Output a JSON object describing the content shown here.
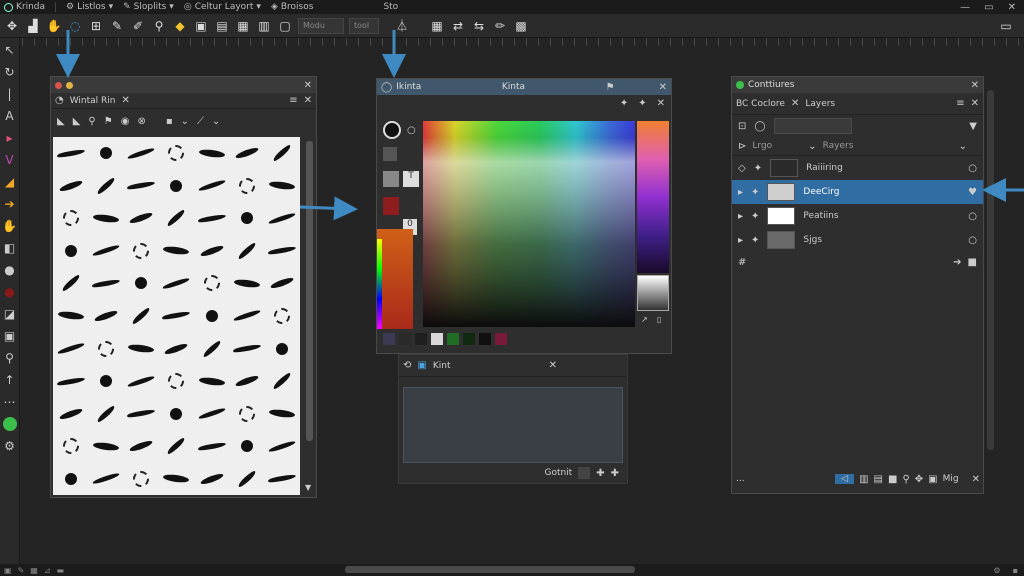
{
  "menubar": {
    "items": [
      {
        "label": "Krinda"
      },
      {
        "label": "Listlos"
      },
      {
        "label": "Sloplits"
      },
      {
        "label": "Celtur Layort"
      },
      {
        "label": "Broisos"
      },
      {
        "label": "Sto"
      }
    ]
  },
  "toolbar": {
    "field1": "Modu",
    "field2": "tool"
  },
  "brush_panel": {
    "tab_label": "Wintal Rin"
  },
  "color_panel": {
    "title_left": "Ikinta",
    "title_center": "Kinta",
    "swatch_label": "0",
    "colors": {
      "fg": "#111111",
      "red": "#8e1d1d",
      "orange": "#d06018"
    },
    "palette": [
      "#3a3a55",
      "#2a2a2a",
      "#1f1f1f",
      "#d8d8d8",
      "#1f6e23",
      "#0f2a10",
      "#101010",
      "#7a1a3a"
    ]
  },
  "sub_panel": {
    "tab_label": "Kint",
    "footer_label": "Gotnit"
  },
  "layers_panel": {
    "title": "Conttiures",
    "tabs": [
      "BC Coclore",
      "Layers"
    ],
    "header_left": "Lrgo",
    "header_right": "Rayers",
    "layers": [
      {
        "name": "Raiiiring",
        "selected": false,
        "thumb": "#2a2a2a"
      },
      {
        "name": "DeeCirg",
        "selected": true,
        "thumb": "#cfcfcf"
      },
      {
        "name": "Peatiins",
        "selected": false,
        "thumb": "#ffffff"
      },
      {
        "name": "Sjgs",
        "selected": false,
        "thumb": "#6a6a6a"
      }
    ],
    "footer_label": "Mig"
  }
}
